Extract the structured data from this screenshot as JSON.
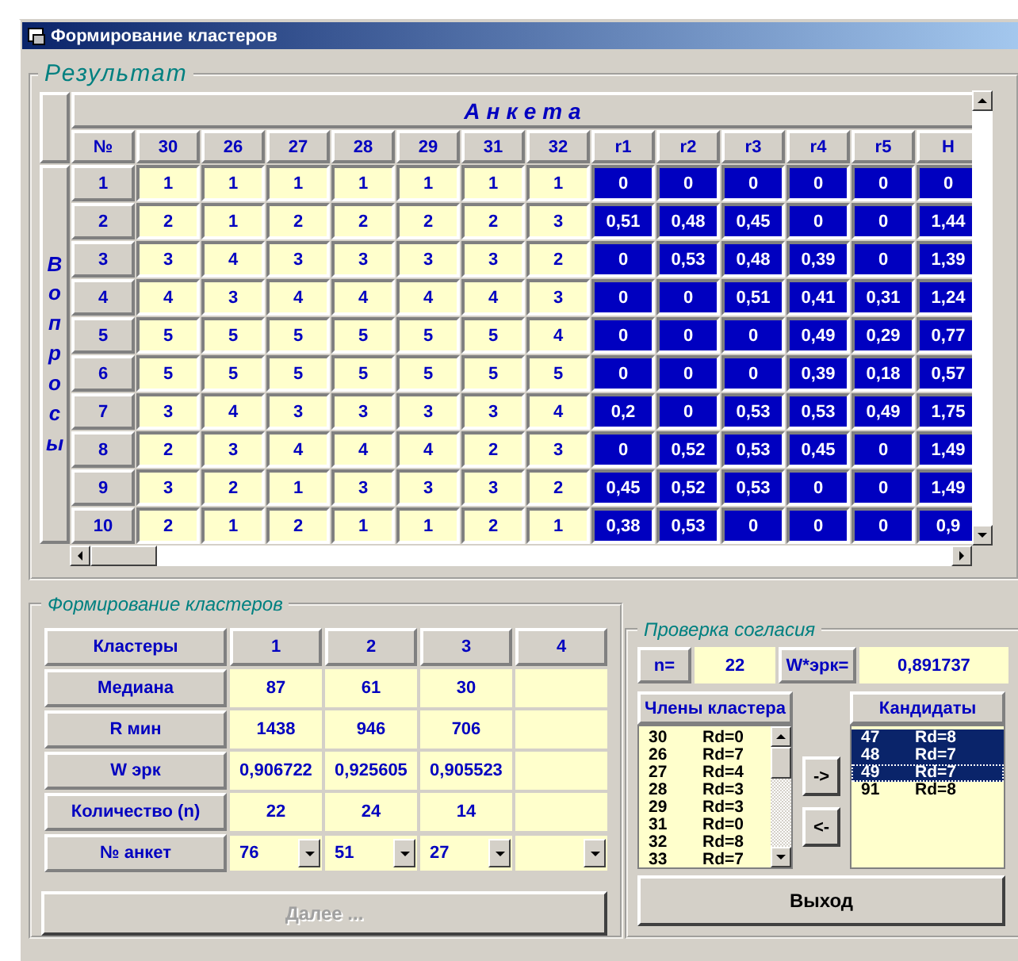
{
  "window": {
    "title": "Формирование кластеров"
  },
  "result": {
    "title": "Результат",
    "header": "Анкета",
    "side_label": "Вопросы",
    "columns": [
      {
        "label": "№",
        "kind": "index"
      },
      {
        "label": "30",
        "kind": "answer"
      },
      {
        "label": "26",
        "kind": "answer"
      },
      {
        "label": "27",
        "kind": "answer"
      },
      {
        "label": "28",
        "kind": "answer"
      },
      {
        "label": "29",
        "kind": "answer"
      },
      {
        "label": "31",
        "kind": "answer"
      },
      {
        "label": "32",
        "kind": "answer"
      },
      {
        "label": "r1",
        "kind": "result"
      },
      {
        "label": "r2",
        "kind": "result"
      },
      {
        "label": "r3",
        "kind": "result"
      },
      {
        "label": "r4",
        "kind": "result"
      },
      {
        "label": "r5",
        "kind": "result"
      },
      {
        "label": "H",
        "kind": "result"
      }
    ],
    "rows": [
      [
        "1",
        "1",
        "1",
        "1",
        "1",
        "1",
        "1",
        "1",
        "0",
        "0",
        "0",
        "0",
        "0",
        "0"
      ],
      [
        "2",
        "2",
        "1",
        "2",
        "2",
        "2",
        "2",
        "3",
        "0,51",
        "0,48",
        "0,45",
        "0",
        "0",
        "1,44"
      ],
      [
        "3",
        "3",
        "4",
        "3",
        "3",
        "3",
        "3",
        "2",
        "0",
        "0,53",
        "0,48",
        "0,39",
        "0",
        "1,39"
      ],
      [
        "4",
        "4",
        "3",
        "4",
        "4",
        "4",
        "4",
        "3",
        "0",
        "0",
        "0,51",
        "0,41",
        "0,31",
        "1,24"
      ],
      [
        "5",
        "5",
        "5",
        "5",
        "5",
        "5",
        "5",
        "4",
        "0",
        "0",
        "0",
        "0,49",
        "0,29",
        "0,77"
      ],
      [
        "6",
        "5",
        "5",
        "5",
        "5",
        "5",
        "5",
        "5",
        "0",
        "0",
        "0",
        "0,39",
        "0,18",
        "0,57"
      ],
      [
        "7",
        "3",
        "4",
        "3",
        "3",
        "3",
        "3",
        "4",
        "0,2",
        "0",
        "0,53",
        "0,53",
        "0,49",
        "1,75"
      ],
      [
        "8",
        "2",
        "3",
        "4",
        "4",
        "4",
        "2",
        "3",
        "0",
        "0,52",
        "0,53",
        "0,45",
        "0",
        "1,49"
      ],
      [
        "9",
        "3",
        "2",
        "1",
        "3",
        "3",
        "3",
        "2",
        "0,45",
        "0,52",
        "0,53",
        "0",
        "0",
        "1,49"
      ],
      [
        "10",
        "2",
        "1",
        "2",
        "1",
        "1",
        "2",
        "1",
        "0,38",
        "0,53",
        "0",
        "0",
        "0",
        "0,9"
      ]
    ]
  },
  "clusters": {
    "title": "Формирование кластеров",
    "columns": [
      "Кластеры",
      "1",
      "2",
      "3",
      "4"
    ],
    "rows": [
      {
        "label": "Медиана",
        "kind": "value",
        "values": [
          "87",
          "61",
          "30"
        ]
      },
      {
        "label": "R мин",
        "kind": "value",
        "values": [
          "1438",
          "946",
          "706"
        ]
      },
      {
        "label": "W эрк",
        "kind": "value",
        "values": [
          "0,906722",
          "0,925605",
          "0,905523"
        ]
      },
      {
        "label": "Количество (n)",
        "kind": "value",
        "values": [
          "22",
          "24",
          "14"
        ]
      },
      {
        "label": "№ анкет",
        "kind": "dropdown",
        "values": [
          "76",
          "51",
          "27"
        ]
      }
    ],
    "next_button": {
      "label": "Далее ...",
      "disabled": true
    }
  },
  "agreement": {
    "title": "Проверка согласия",
    "n_label": "n=",
    "n_value": "22",
    "w_label": "W*эрк=",
    "w_value": "0,891737",
    "members": {
      "title": "Члены кластера",
      "items": [
        {
          "id": "30",
          "rd": "Rd=0"
        },
        {
          "id": "26",
          "rd": "Rd=7"
        },
        {
          "id": "27",
          "rd": "Rd=4"
        },
        {
          "id": "28",
          "rd": "Rd=3"
        },
        {
          "id": "29",
          "rd": "Rd=3"
        },
        {
          "id": "31",
          "rd": "Rd=0"
        },
        {
          "id": "32",
          "rd": "Rd=8"
        },
        {
          "id": "33",
          "rd": "Rd=7"
        }
      ]
    },
    "add_button": "->",
    "remove_button": "<-",
    "candidates": {
      "title": "Кандидаты",
      "items": [
        {
          "id": "47",
          "rd": "Rd=8",
          "selected": true,
          "focused": false
        },
        {
          "id": "48",
          "rd": "Rd=7",
          "selected": true,
          "focused": false
        },
        {
          "id": "49",
          "rd": "Rd=7",
          "selected": true,
          "focused": true
        },
        {
          "id": "91",
          "rd": "Rd=8",
          "selected": false,
          "focused": false
        }
      ]
    },
    "exit_button": "Выход"
  }
}
